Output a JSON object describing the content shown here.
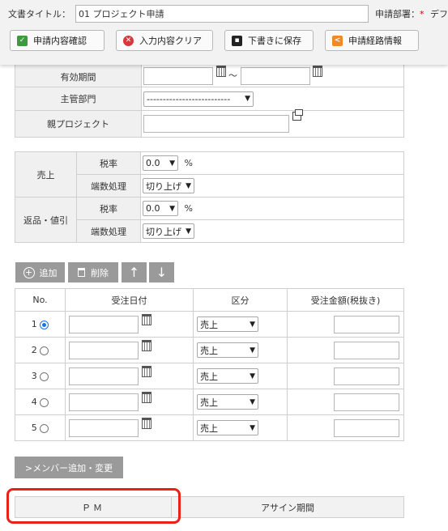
{
  "header": {
    "title_label": "文書タイトル：",
    "title_value": "01 プロジェクト申請",
    "dept_label": "申請部署：",
    "dept_required": "*",
    "dept_value": "デフ",
    "buttons": {
      "confirm": "申請内容確認",
      "clear": "入力内容クリア",
      "draft": "下書きに保存",
      "route": "申請経路情報"
    }
  },
  "form": {
    "period_label": "有効期間",
    "period_sep": "～",
    "dept_label": "主管部門",
    "dept_select": "--------------------------",
    "parent_label": "親プロジェクト"
  },
  "tax": {
    "sales_label": "売上",
    "returns_label": "返品・値引",
    "rate_label": "税率",
    "rounding_label": "端数処理",
    "rate_value": "0.0",
    "rate_unit": "%",
    "rounding_value": "切り上げ"
  },
  "orders": {
    "toolbar": {
      "add": "追加",
      "delete": "削除"
    },
    "columns": [
      "No.",
      "受注日付",
      "区分",
      "受注金額(税抜き)"
    ],
    "rows": [
      {
        "no": "1",
        "selected": true,
        "kubun": "売上"
      },
      {
        "no": "2",
        "selected": false,
        "kubun": "売上"
      },
      {
        "no": "3",
        "selected": false,
        "kubun": "売上"
      },
      {
        "no": "4",
        "selected": false,
        "kubun": "売上"
      },
      {
        "no": "5",
        "selected": false,
        "kubun": "売上"
      }
    ]
  },
  "members": {
    "add_button": ">メンバー追加・変更",
    "columns": [
      "ＰＭ",
      "アサイン期間"
    ]
  },
  "colors": {
    "highlight": "#e8221b",
    "button_gray": "#9a9a9a",
    "radio_selected": "#1a73e8"
  }
}
